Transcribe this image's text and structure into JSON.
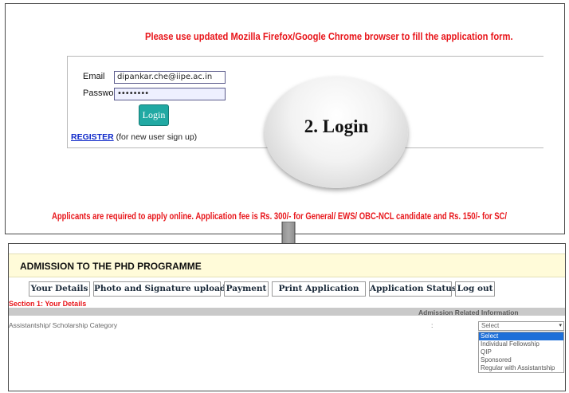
{
  "login_panel": {
    "browser_note": "Please use updated Mozilla Firefox/Google Chrome browser to fill the application form.",
    "email_label": "Email",
    "email_value": "dipankar.che@iipe.ac.in",
    "password_label": "Password",
    "password_value": "••••••••",
    "login_button": "Login",
    "register_link": "REGISTER",
    "register_hint": "(for new user sign up)",
    "fee_note": "Applicants are required to apply online. Application fee is Rs. 300/- for General/ EWS/ OBC-NCL candidate and Rs. 150/- for SC/"
  },
  "callout": {
    "text": "2. Login"
  },
  "admission": {
    "title": "ADMISSION TO THE PHD PROGRAMME",
    "tabs": [
      "Your Details",
      "Photo and Signature upload",
      "Payment",
      "Print Application",
      "Application Status",
      "Log out"
    ],
    "section_label": "Section 1: Your Details",
    "bar_label": "Admission Related Information",
    "field_label": "Assistantship/ Scholarship Category",
    "colon": ":",
    "select_value": "Select",
    "options": [
      "Select",
      "Individual Fellowship",
      "QIP",
      "Sponsored",
      "Regular with Assistantship"
    ]
  },
  "colors": {
    "alert_red": "#e8161b",
    "login_button": "#21a9a3",
    "header_bg": "#fffbd9",
    "selected_option": "#1e6fd9"
  }
}
